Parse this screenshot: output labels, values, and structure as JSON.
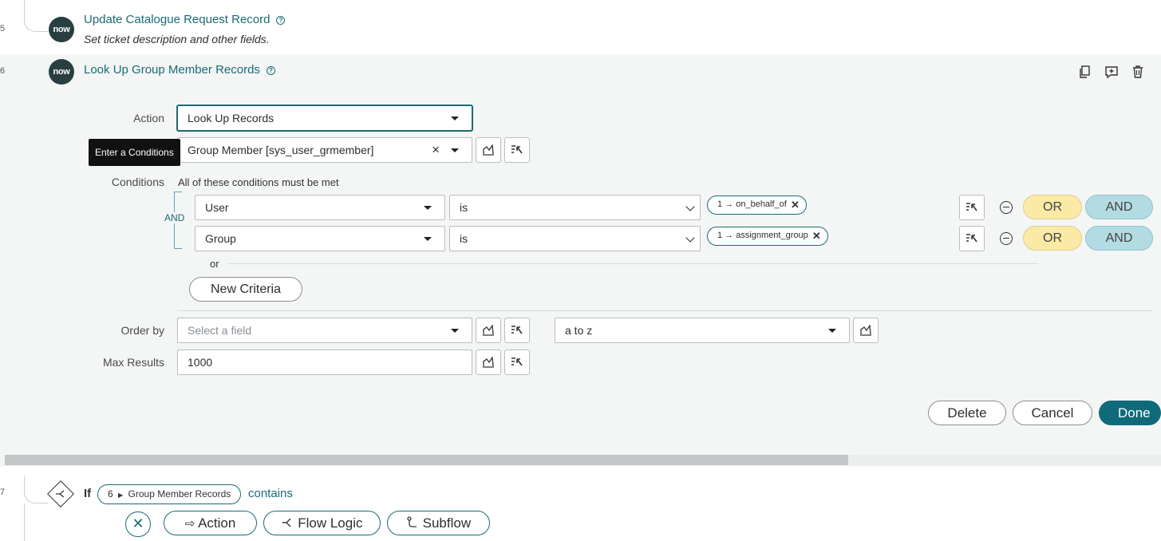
{
  "steps": {
    "prev": {
      "number": "5",
      "badge": "now",
      "title": "Update Catalogue Request Record",
      "subtitle": "Set ticket description and other fields."
    },
    "current": {
      "number": "6",
      "badge": "now",
      "title": "Look Up Group Member Records"
    },
    "next": {
      "number": "7",
      "if_label": "If",
      "pill_index": "6",
      "pill_text": "Group Member Records",
      "operator": "contains"
    }
  },
  "form": {
    "action_label": "Action",
    "action_value": "Look Up Records",
    "table_value": "Group Member [sys_user_grmember]",
    "tooltip": "Enter a Conditions",
    "conditions_label": "Conditions",
    "conditions_note": "All of these conditions must be met",
    "and_label": "AND",
    "conditions": [
      {
        "field": "User",
        "operator": "is",
        "value": "1 → on_behalf_of",
        "or": "OR",
        "and": "AND"
      },
      {
        "field": "Group",
        "operator": "is",
        "value": "1 → assignment_group",
        "or": "OR",
        "and": "AND"
      }
    ],
    "or_text": "or",
    "new_criteria": "New Criteria",
    "order_by_label": "Order by",
    "order_by_placeholder": "Select a field",
    "sort_value": "a to z",
    "max_results_label": "Max Results",
    "max_results_value": "1000"
  },
  "footer_buttons": {
    "delete": "Delete",
    "cancel": "Cancel",
    "done": "Done"
  },
  "add_buttons": {
    "action": "Action",
    "flow_logic": "Flow Logic",
    "subflow": "Subflow"
  },
  "colors": {
    "accent": "#1a6b75",
    "primary_button": "#0f6b7a",
    "or_pill": "#fbeaa6",
    "and_pill": "#b3dbe2",
    "badge": "#293e40",
    "panel_bg": "#f4f5f5"
  }
}
